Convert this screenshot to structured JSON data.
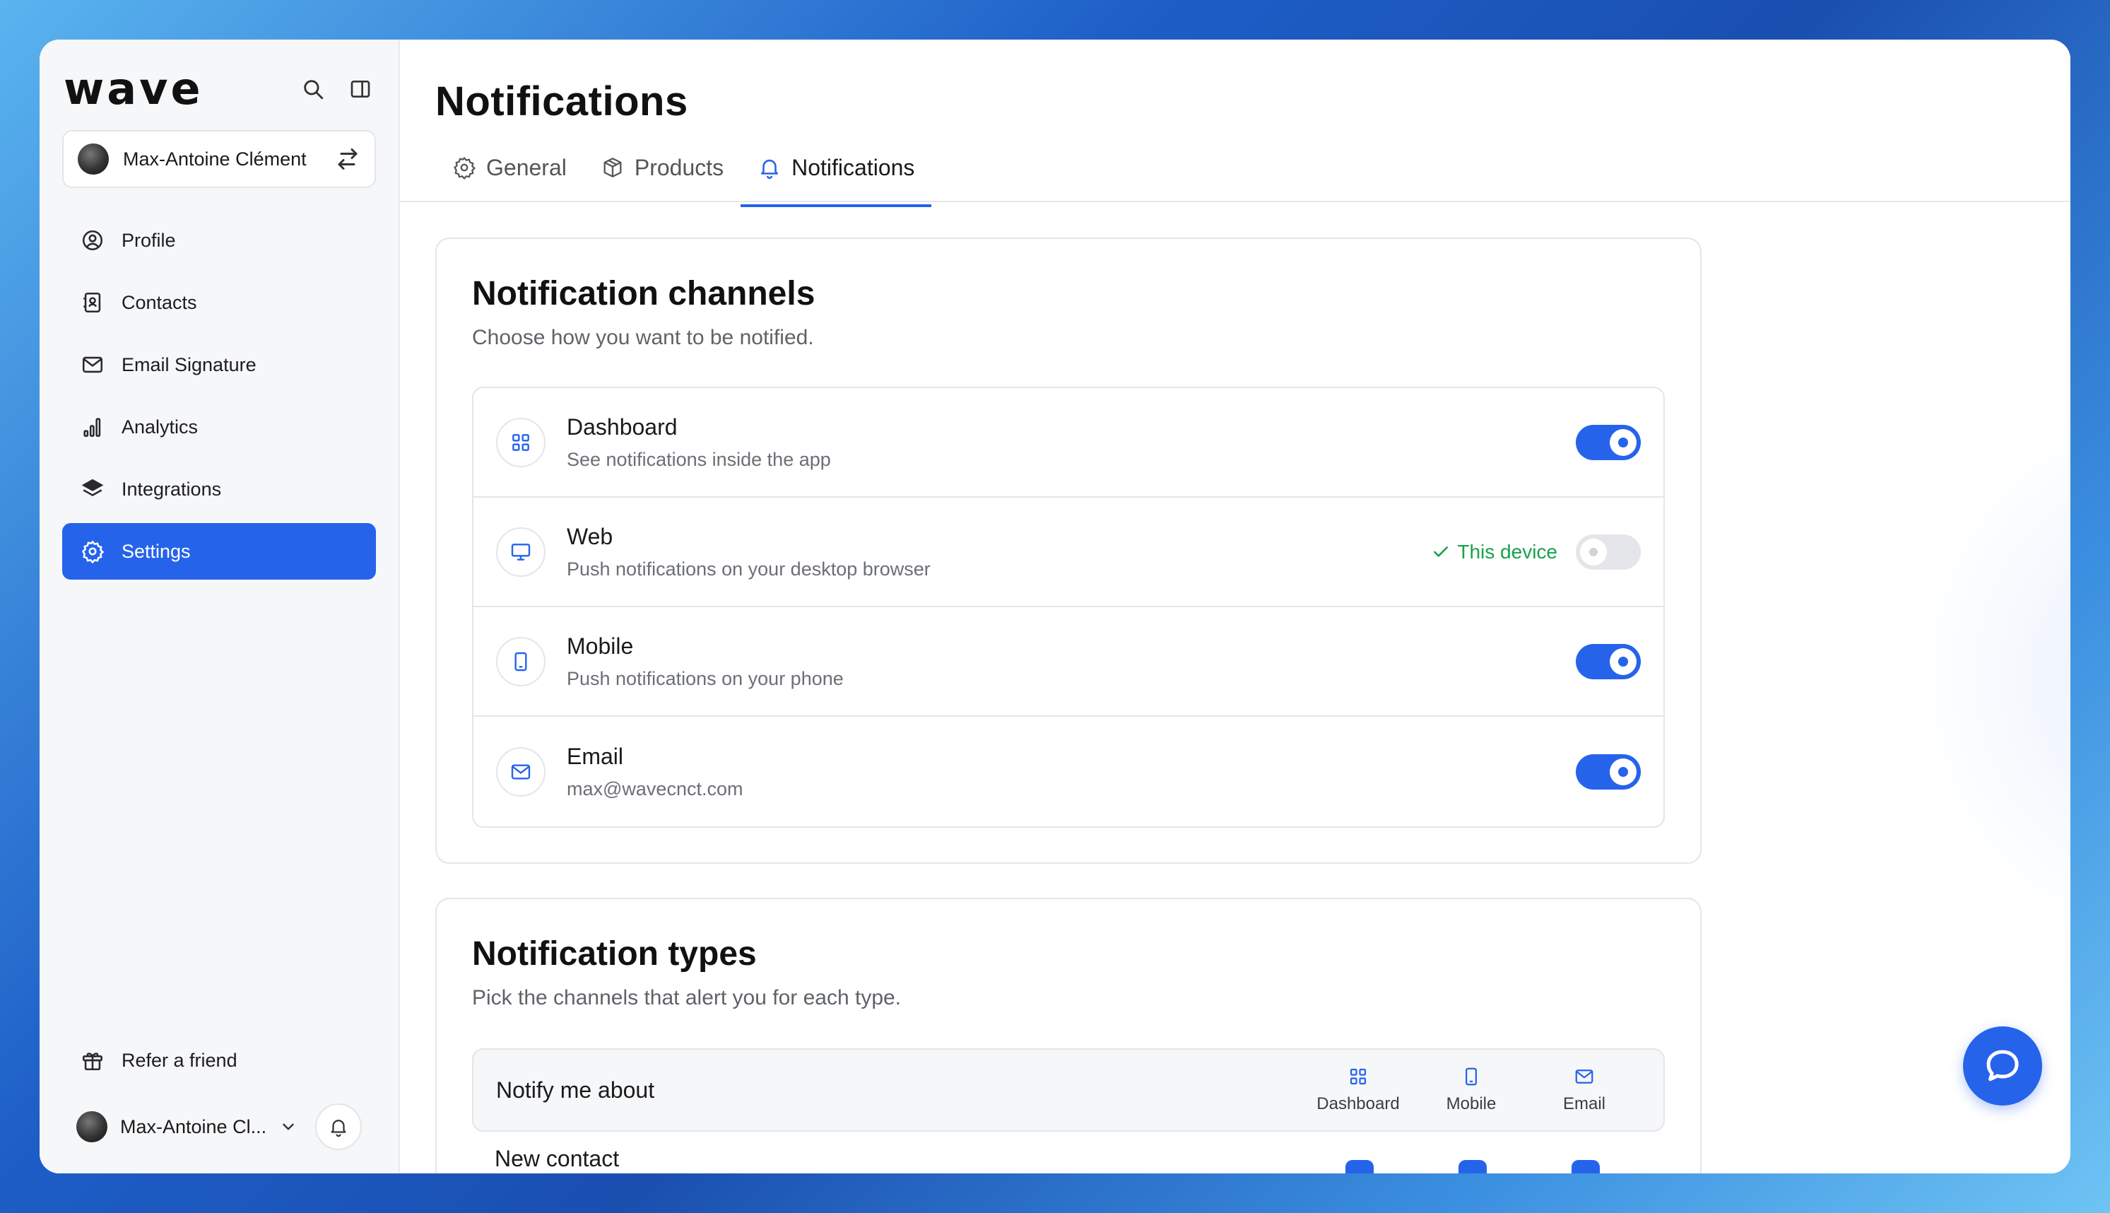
{
  "app": {
    "logo": "wave"
  },
  "account": {
    "name": "Max-Antoine Clément"
  },
  "sidebar": {
    "items": [
      {
        "label": "Profile",
        "icon": "user-circle-icon"
      },
      {
        "label": "Contacts",
        "icon": "contacts-book-icon"
      },
      {
        "label": "Email Signature",
        "icon": "mail-icon"
      },
      {
        "label": "Analytics",
        "icon": "bar-chart-icon"
      },
      {
        "label": "Integrations",
        "icon": "layers-icon"
      },
      {
        "label": "Settings",
        "icon": "gear-icon",
        "active": true
      }
    ],
    "refer_label": "Refer a friend",
    "user_name": "Max-Antoine Cl..."
  },
  "header": {
    "title": "Notifications",
    "tabs": [
      {
        "label": "General",
        "icon": "gear-icon"
      },
      {
        "label": "Products",
        "icon": "box-icon"
      },
      {
        "label": "Notifications",
        "icon": "bell-icon",
        "active": true
      }
    ]
  },
  "channels_card": {
    "title": "Notification channels",
    "subtitle": "Choose how you want to be notified.",
    "channels": [
      {
        "title": "Dashboard",
        "desc": "See notifications inside the app",
        "enabled": true,
        "icon": "dashboard-grid-icon"
      },
      {
        "title": "Web",
        "desc": "Push notifications on your desktop browser",
        "enabled": false,
        "badge": "This device",
        "icon": "monitor-icon"
      },
      {
        "title": "Mobile",
        "desc": "Push notifications on your phone",
        "enabled": true,
        "icon": "phone-icon"
      },
      {
        "title": "Email",
        "desc": "max@wavecnct.com",
        "enabled": true,
        "icon": "mail-icon"
      }
    ]
  },
  "types_card": {
    "title": "Notification types",
    "subtitle": "Pick the channels that alert you for each type.",
    "header_label": "Notify me about",
    "columns": [
      "Dashboard",
      "Mobile",
      "Email"
    ],
    "rows": [
      {
        "label": "New contact"
      }
    ]
  },
  "colors": {
    "accent": "#2563eb",
    "success": "#16a34a"
  }
}
